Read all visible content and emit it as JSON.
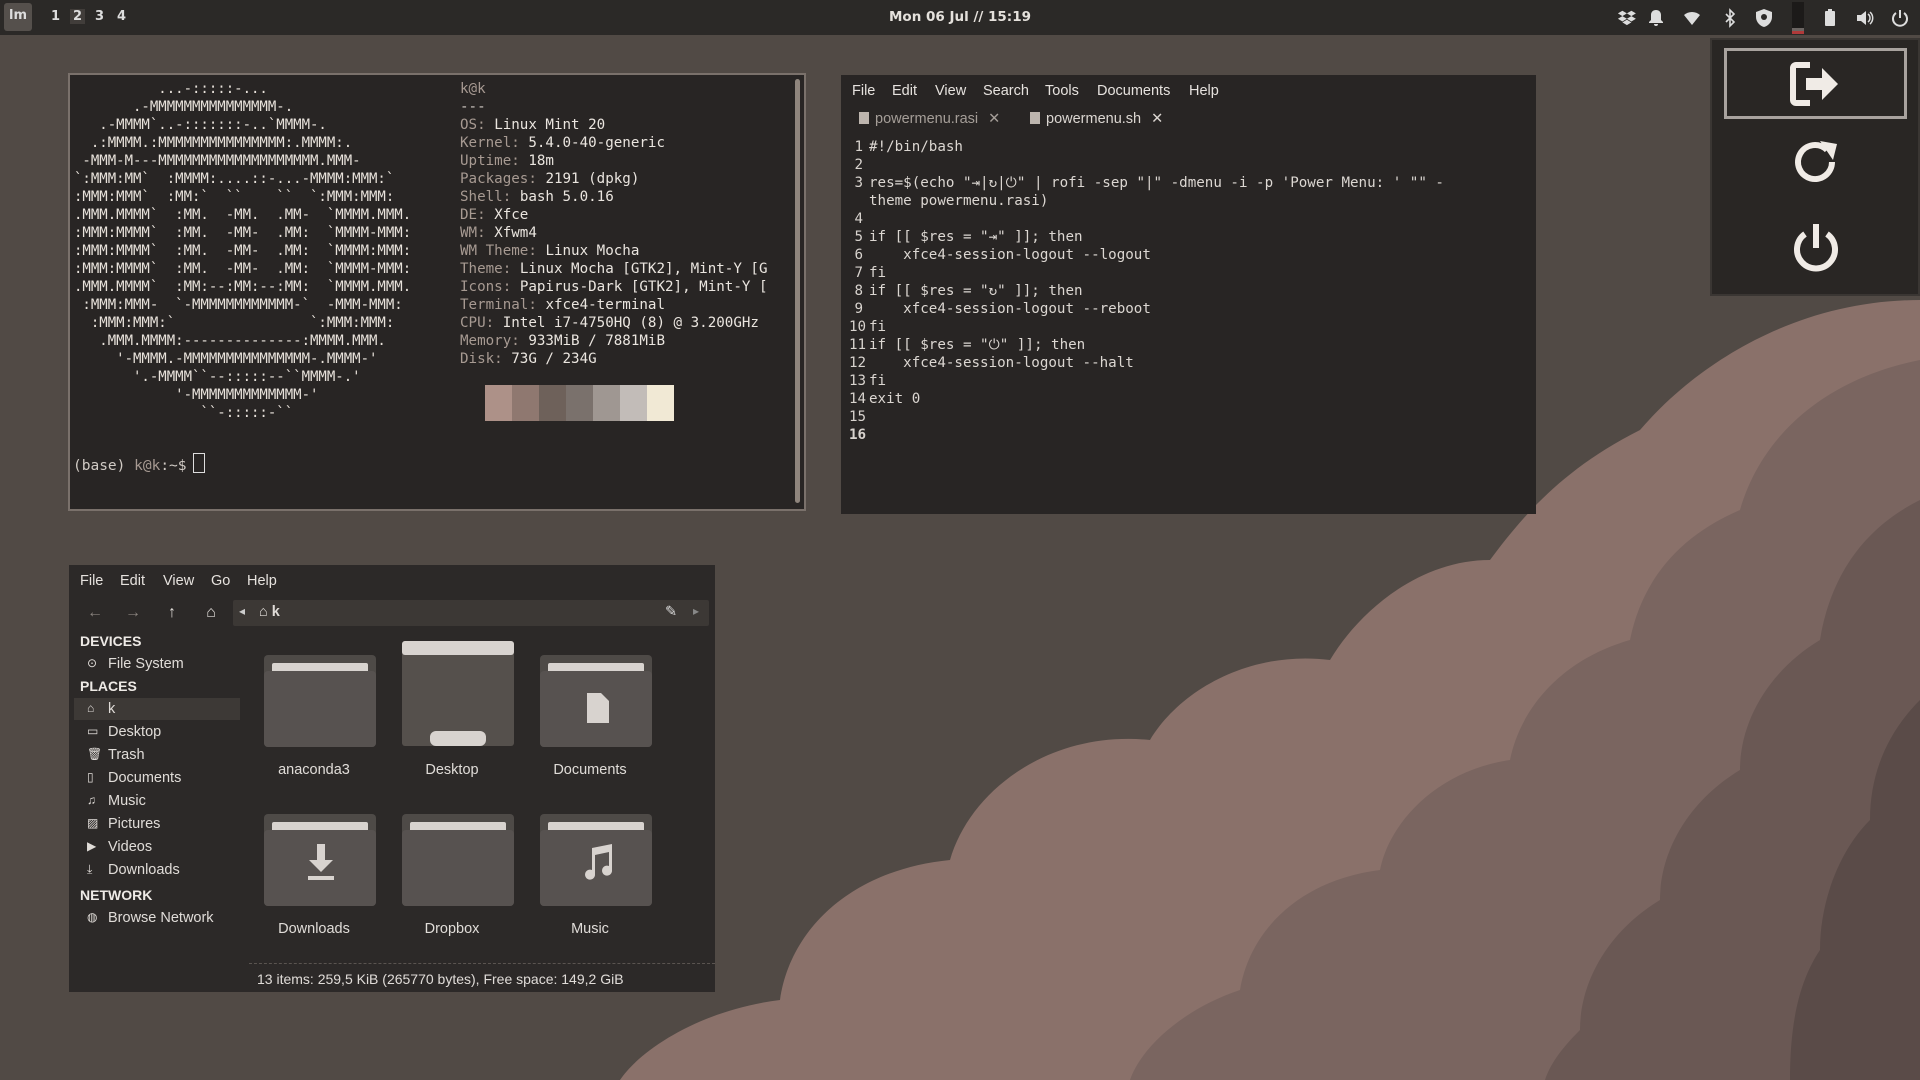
{
  "panel": {
    "logo": "lm",
    "workspaces": [
      "1",
      "2",
      "3",
      "4"
    ],
    "active_workspace": "2",
    "clock": "Mon 06 Jul // 15:19",
    "tray_icons": [
      "dropbox-icon",
      "bell-icon",
      "wifi-icon",
      "bluetooth-icon",
      "shield-icon",
      "cpu-graph-icon",
      "battery-icon",
      "volume-icon",
      "power-icon"
    ]
  },
  "terminal": {
    "ascii_logo": [
      "          ...-:::::-...",
      "       .-MMMMMMMMMMMMMMM-.",
      "   .-MMMM`..-:::::::-..`MMMM-.",
      "  .:MMMM.:MMMMMMMMMMMMMMM:.MMMM:.",
      " -MMM-M---MMMMMMMMMMMMMMMMMMM.MMM-",
      "`:MMM:MM`  :MMMM:....::-...-MMMM:MMM:`",
      ":MMM:MMM`  :MM:`  ``    ``  `:MMM:MMM:",
      ".MMM.MMMM`  :MM.  -MM.  .MM-  `MMMM.MMM.",
      ":MMM:MMMM`  :MM.  -MM-  .MM:  `MMMM-MMM:",
      ":MMM:MMMM`  :MM.  -MM-  .MM:  `MMMM:MMM:",
      ":MMM:MMMM`  :MM.  -MM-  .MM:  `MMMM-MMM:",
      ".MMM.MMMM`  :MM:--:MM:--:MM:  `MMMM.MMM.",
      " :MMM:MMM-  `-MMMMMMMMMMMM-`  -MMM-MMM:",
      "  :MMM:MMM:`                `:MMM:MMM:",
      "   .MMM.MMMM:--------------:MMMM.MMM.",
      "     '-MMMM.-MMMMMMMMMMMMMMM-.MMMM-'",
      "       '.-MMMM``--:::::--``MMMM-.'",
      "            '-MMMMMMMMMMMMM-'",
      "               ``-:::::-``"
    ],
    "user_host": "k@k",
    "separator": "---",
    "info": [
      {
        "key": "OS",
        "value": "Linux Mint 20"
      },
      {
        "key": "Kernel",
        "value": "5.4.0-40-generic"
      },
      {
        "key": "Uptime",
        "value": "18m"
      },
      {
        "key": "Packages",
        "value": "2191 (dpkg)"
      },
      {
        "key": "Shell",
        "value": "bash 5.0.16"
      },
      {
        "key": "DE",
        "value": "Xfce"
      },
      {
        "key": "WM",
        "value": "Xfwm4"
      },
      {
        "key": "WM Theme",
        "value": "Linux Mocha"
      },
      {
        "key": "Theme",
        "value": "Linux Mocha [GTK2], Mint-Y [G"
      },
      {
        "key": "Icons",
        "value": "Papirus-Dark [GTK2], Mint-Y ["
      },
      {
        "key": "Terminal",
        "value": "xfce4-terminal"
      },
      {
        "key": "CPU",
        "value": "Intel i7-4750HQ (8) @ 3.200GHz"
      },
      {
        "key": "Memory",
        "value": "933MiB / 7881MiB"
      },
      {
        "key": "Disk",
        "value": "73G / 234G"
      }
    ],
    "swatches": [
      "#ad9188",
      "#8f7870",
      "#6e615a",
      "#7a716c",
      "#9f9792",
      "#c2bcb8",
      "#f1e9d5"
    ],
    "prompt_env": "(base)",
    "prompt_user": "k@k",
    "prompt_path": ":~$"
  },
  "editor": {
    "menu": [
      "File",
      "Edit",
      "View",
      "Search",
      "Tools",
      "Documents",
      "Help"
    ],
    "tabs": [
      {
        "label": "powermenu.rasi",
        "active": false
      },
      {
        "label": "powermenu.sh",
        "active": true
      }
    ],
    "lines": [
      {
        "n": "1",
        "text": "#!/bin/bash"
      },
      {
        "n": "2",
        "text": ""
      },
      {
        "n": "3",
        "text": "res=$(echo \"⇥|↻|⏻\" | rofi -sep \"|\" -dmenu -i -p 'Power Menu: ' \"\" -"
      },
      {
        "n": "",
        "text": "theme powermenu.rasi)"
      },
      {
        "n": "4",
        "text": ""
      },
      {
        "n": "5",
        "text": "if [[ $res = \"⇥\" ]]; then"
      },
      {
        "n": "6",
        "text": "    xfce4-session-logout --logout"
      },
      {
        "n": "7",
        "text": "fi"
      },
      {
        "n": "8",
        "text": "if [[ $res = \"↻\" ]]; then"
      },
      {
        "n": "9",
        "text": "    xfce4-session-logout --reboot"
      },
      {
        "n": "10",
        "text": "fi"
      },
      {
        "n": "11",
        "text": "if [[ $res = \"⏻\" ]]; then"
      },
      {
        "n": "12",
        "text": "    xfce4-session-logout --halt"
      },
      {
        "n": "13",
        "text": "fi"
      },
      {
        "n": "14",
        "text": "exit 0"
      },
      {
        "n": "15",
        "text": ""
      },
      {
        "n": "16",
        "text": ""
      }
    ]
  },
  "filemanager": {
    "menu": [
      "File",
      "Edit",
      "View",
      "Go",
      "Help"
    ],
    "path": "k",
    "sections": {
      "devices": "DEVICES",
      "places": "PLACES",
      "network": "NETWORK"
    },
    "devices": [
      {
        "label": "File System",
        "icon": "drive-icon"
      }
    ],
    "places": [
      {
        "label": "k",
        "icon": "home-icon",
        "selected": true
      },
      {
        "label": "Desktop",
        "icon": "desktop-icon"
      },
      {
        "label": "Trash",
        "icon": "trash-icon"
      },
      {
        "label": "Documents",
        "icon": "document-icon"
      },
      {
        "label": "Music",
        "icon": "music-icon"
      },
      {
        "label": "Pictures",
        "icon": "picture-icon"
      },
      {
        "label": "Videos",
        "icon": "video-icon"
      },
      {
        "label": "Downloads",
        "icon": "download-icon"
      }
    ],
    "network": [
      {
        "label": "Browse Network",
        "icon": "network-icon"
      }
    ],
    "folders": [
      {
        "label": "anaconda3",
        "icon": "folder-icon"
      },
      {
        "label": "Desktop",
        "icon": "desktop-folder-icon"
      },
      {
        "label": "Documents",
        "icon": "documents-folder-icon"
      },
      {
        "label": "Downloads",
        "icon": "downloads-folder-icon"
      },
      {
        "label": "Dropbox",
        "icon": "folder-icon"
      },
      {
        "label": "Music",
        "icon": "music-folder-icon"
      }
    ],
    "status": "13 items: 259,5 KiB (265770 bytes), Free space: 149,2 GiB"
  },
  "powermenu": {
    "items": [
      {
        "name": "logout",
        "icon": "logout-icon",
        "selected": true
      },
      {
        "name": "reboot",
        "icon": "reboot-icon",
        "selected": false
      },
      {
        "name": "shutdown",
        "icon": "power-icon",
        "selected": false
      }
    ]
  }
}
